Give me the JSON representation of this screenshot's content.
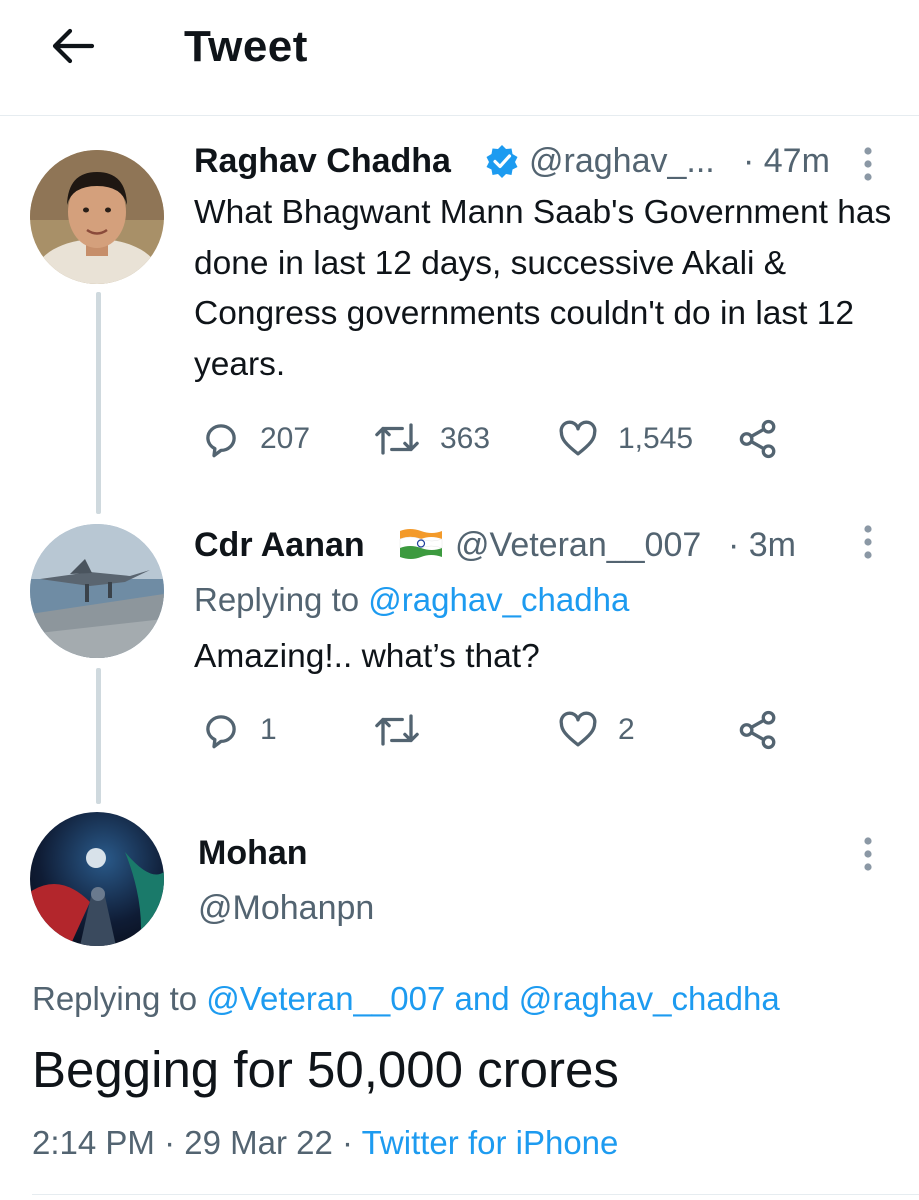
{
  "header": {
    "title": "Tweet",
    "back_icon": "arrow-left-icon"
  },
  "colors": {
    "link": "#1d9bf0",
    "muted": "#536471",
    "text": "#0f1419",
    "verified": "#1d9bf0",
    "thread_line": "#cfd9de"
  },
  "tweets": [
    {
      "name": "Raghav Chadha",
      "verified": true,
      "handle": "@raghav_...",
      "time": "· 47m",
      "text": "What Bhagwant Mann Saab's Government has done in last 12 days, successive Akali & Congress governments couldn't do in last 12 years.",
      "replies": "207",
      "retweets": "363",
      "likes": "1,545"
    },
    {
      "name": "Cdr Aanan",
      "flag": "india-flag-emoji",
      "handle": "@Veteran__007",
      "time": "· 3m",
      "replying_label": "Replying to",
      "replying_to": "@raghav_chadha",
      "text": "Amazing!.. what’s that?",
      "replies": "1",
      "retweets": "",
      "likes": "2"
    }
  ],
  "main_tweet": {
    "name": "Mohan",
    "handle": "@Mohanpn",
    "replying_label": "Replying to",
    "replying_to_1": "@Veteran__007",
    "replying_and": "and",
    "replying_to_2": "@raghav_chadha",
    "text": "Begging for 50,000 crores",
    "time": "2:14 PM",
    "date": "29 Mar 22",
    "separator": "·",
    "source": "Twitter for iPhone"
  }
}
